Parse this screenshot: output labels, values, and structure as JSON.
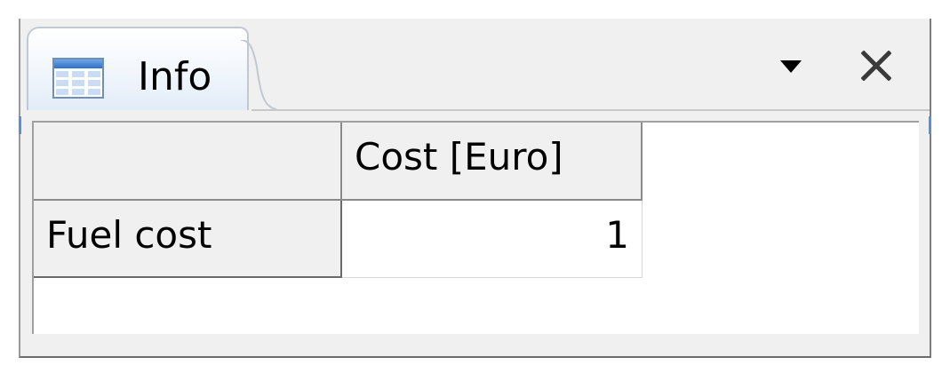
{
  "panel": {
    "tab": {
      "title": "Info",
      "icon": "table-icon"
    },
    "controls": {
      "dropdown_icon": "triangle-down-icon",
      "close_icon": "close-icon"
    }
  },
  "grid": {
    "corner_label": "",
    "columns": [
      "Cost [Euro]"
    ],
    "rows": [
      {
        "label": "Fuel cost",
        "values": [
          "1"
        ]
      }
    ]
  },
  "colors": {
    "tab_gradient_top": "#ffffff",
    "tab_gradient_bottom": "#e2ecf8",
    "panel_background": "#f0f0f0",
    "accent": "#5b8fd0"
  }
}
